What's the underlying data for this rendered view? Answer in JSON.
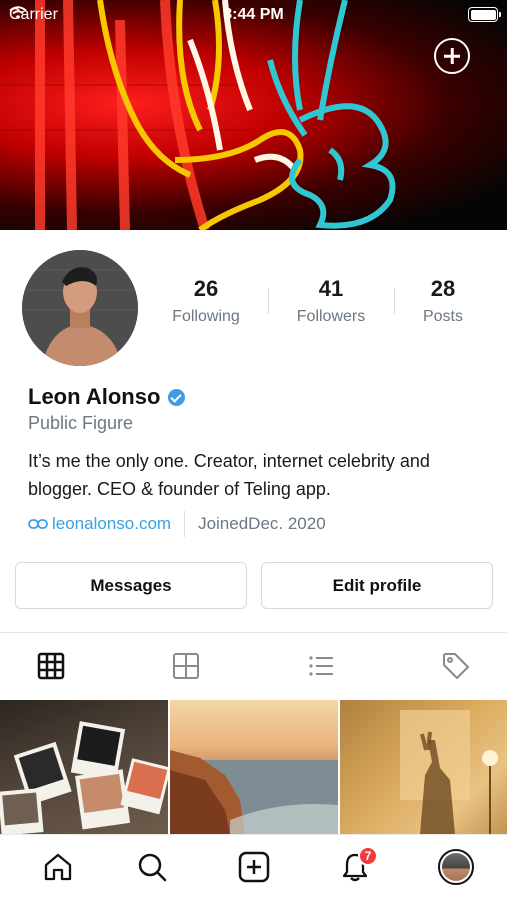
{
  "status_bar": {
    "carrier": "Carrier",
    "time": "8:44 PM",
    "battery_level": 1.0
  },
  "cover": {
    "image": "neon peace sign",
    "add_icon": "plus-circle-icon"
  },
  "profile": {
    "name": "Leon Alonso",
    "role": "Public Figure",
    "bio": "It’s me the only one. Creator, internet celebrity and blogger. CEO & founder of Teling app.",
    "link": "leonalonso.com",
    "joined": "JoinedDec. 2020"
  },
  "stats": [
    {
      "value": "26",
      "label": "Following"
    },
    {
      "value": "41",
      "label": "Followers"
    },
    {
      "value": "28",
      "label": "Posts"
    }
  ],
  "buttons": {
    "messages": "Messages",
    "edit_profile": "Edit profile"
  },
  "tabs": [
    "grid-icon",
    "collection-icon",
    "list-icon",
    "tag-icon"
  ],
  "bottom_nav": {
    "items": [
      "home-icon",
      "search-icon",
      "create-icon",
      "notifications-icon",
      "profile-avatar"
    ],
    "notifications_badge": "7"
  },
  "colors": {
    "accent": "#3aa0e6",
    "badge": "#ef3b3b",
    "verified": "#3d9be9"
  }
}
